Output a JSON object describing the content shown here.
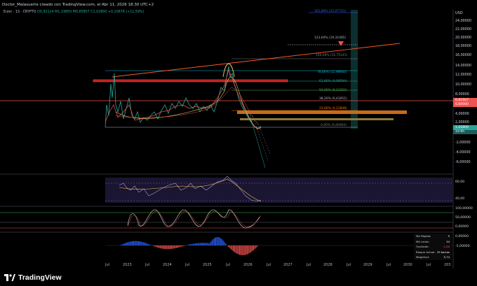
{
  "header": {
    "title": "Doctor_Malasuerte creado con TradingView.com, el Abr 11, 2026 18:30 UTC+2"
  },
  "symbol": {
    "name": "Euler · 1S · CRYPTO",
    "open": "O0,92124",
    "high": "M1,19850",
    "low": "M0,85807",
    "close": "C1,02800",
    "change": "+0,10676 (+11,59%)"
  },
  "price_axis": {
    "currency": "USD",
    "ticks": [
      "24,00000",
      "22,00000",
      "20,00000",
      "18,00000",
      "16,00000",
      "14,00000",
      "12,00000",
      "10,00000",
      "8,00000",
      "6,00000",
      "4,00000",
      "2,00000",
      "-2,00000",
      "-4,00000",
      "-6,00000"
    ],
    "red_tag": "6,81607",
    "red_tag_sub": "6,60000",
    "green_tag": "1,02800",
    "green_tag_sub": "1d 6h"
  },
  "fib_levels": [
    {
      "label": "161,80% (25,07721)",
      "color": "#2962ff"
    },
    {
      "label": "123,60% (19,31085)",
      "color": "#b2b5be"
    },
    {
      "label": "100,00% (15,75141)",
      "color": "#787b86"
    },
    {
      "label": "78,60% (12,98682)",
      "color": "#00bcd4"
    },
    {
      "label": "61,80% (9,98594)",
      "color": "#26a69a"
    },
    {
      "label": "50,00% (8,21052)",
      "color": "#4caf50"
    },
    {
      "label": "38,20% (6,43051)",
      "color": "#b2b5be"
    },
    {
      "label": "23,60% (4,22848)",
      "color": "#f57c00"
    },
    {
      "label": "0,00% (0,66904)",
      "color": "#787b86"
    }
  ],
  "oscillators": {
    "rsi_ticks": [
      "60,00",
      "40,00"
    ],
    "stoch_ticks": [
      "100,00000",
      "50,00000",
      "0,00000"
    ],
    "macd_ticks": [
      "0,00000",
      "-5,00000"
    ]
  },
  "info_table": [
    {
      "label": "MA Rápida:",
      "value": "5"
    },
    {
      "label": "MA Lenta:",
      "value": "34"
    },
    {
      "label": "Oscilador:",
      "value": "-1,86"
    },
    {
      "label": "Bloque Actual:",
      "value": "25 barras"
    },
    {
      "label": "Magnitud:",
      "value": "5,74"
    }
  ],
  "time_axis": [
    "Jul",
    "2023",
    "Jul",
    "2024",
    "Jul",
    "2025",
    "Jul",
    "2026",
    "Jul",
    "2027",
    "Jul",
    "2028",
    "Jul",
    "2029",
    "Jul",
    "2030",
    "Jul",
    "203"
  ],
  "footer": {
    "brand": "TradingView"
  },
  "colors": {
    "background": "#000000",
    "up": "#26a69a",
    "down": "#ef5350",
    "trendline": "#ff5722",
    "rsi": "#e8c15a",
    "rsi_band": "#7e57c2"
  }
}
